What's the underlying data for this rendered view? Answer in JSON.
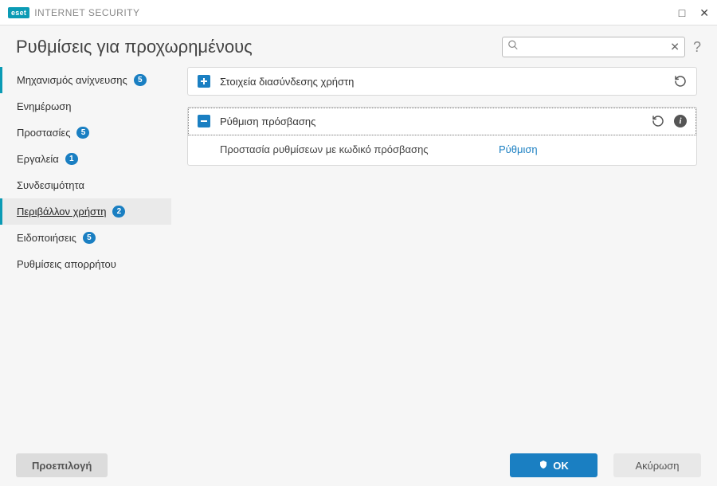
{
  "title_bar": {
    "brand": "eset",
    "product": "INTERNET SECURITY"
  },
  "header": {
    "page_title": "Ρυθμίσεις για προχωρημένους",
    "search_placeholder": ""
  },
  "sidebar": {
    "items": [
      {
        "label": "Μηχανισμός ανίχνευσης",
        "badge": "5",
        "accented": true,
        "active": false
      },
      {
        "label": "Ενημέρωση",
        "badge": null,
        "accented": false,
        "active": false
      },
      {
        "label": "Προστασίες",
        "badge": "5",
        "accented": false,
        "active": false
      },
      {
        "label": "Εργαλεία",
        "badge": "1",
        "accented": false,
        "active": false
      },
      {
        "label": "Συνδεσιμότητα",
        "badge": null,
        "accented": false,
        "active": false
      },
      {
        "label": "Περιβάλλον χρήστη",
        "badge": "2",
        "accented": true,
        "active": true
      },
      {
        "label": "Ειδοποιήσεις",
        "badge": "5",
        "accented": false,
        "active": false
      },
      {
        "label": "Ρυθμίσεις απορρήτου",
        "badge": null,
        "accented": false,
        "active": false
      }
    ]
  },
  "panels": {
    "user_elements": {
      "title": "Στοιχεία διασύνδεσης χρήστη",
      "expanded": false
    },
    "access_setup": {
      "title": "Ρύθμιση πρόσβασης",
      "expanded": true,
      "body_label": "Προστασία ρυθμίσεων με κωδικό πρόσβασης",
      "body_action": "Ρύθμιση"
    }
  },
  "footer": {
    "default_btn": "Προεπιλογή",
    "ok_btn": "OK",
    "cancel_btn": "Ακύρωση"
  }
}
